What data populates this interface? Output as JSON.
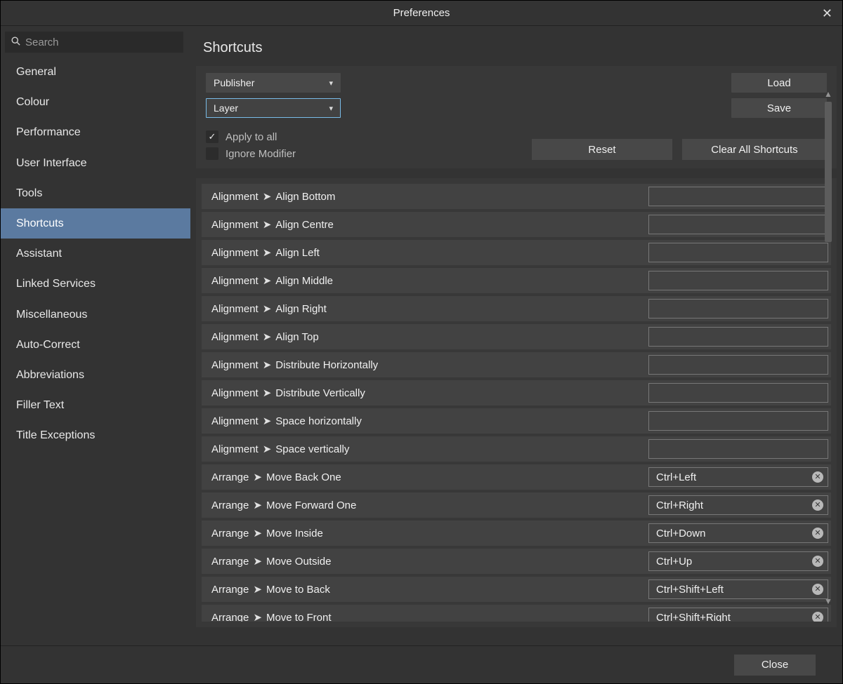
{
  "window": {
    "title": "Preferences"
  },
  "search": {
    "placeholder": "Search"
  },
  "sidebar": {
    "items": [
      {
        "label": "General",
        "selected": false
      },
      {
        "label": "Colour",
        "selected": false
      },
      {
        "label": "Performance",
        "selected": false
      },
      {
        "label": "User Interface",
        "selected": false
      },
      {
        "label": "Tools",
        "selected": false
      },
      {
        "label": "Shortcuts",
        "selected": true
      },
      {
        "label": "Assistant",
        "selected": false
      },
      {
        "label": "Linked Services",
        "selected": false
      },
      {
        "label": "Miscellaneous",
        "selected": false
      },
      {
        "label": "Auto-Correct",
        "selected": false
      },
      {
        "label": "Abbreviations",
        "selected": false
      },
      {
        "label": "Filler Text",
        "selected": false
      },
      {
        "label": "Title Exceptions",
        "selected": false
      }
    ]
  },
  "main": {
    "heading": "Shortcuts",
    "profile_select": "Publisher",
    "category_select": "Layer",
    "load_label": "Load",
    "save_label": "Save",
    "apply_all": {
      "label": "Apply to all",
      "checked": true
    },
    "ignore_modifier": {
      "label": "Ignore Modifier",
      "checked": false
    },
    "reset_label": "Reset",
    "clear_all_label": "Clear All Shortcuts"
  },
  "shortcuts": [
    {
      "group": "Alignment",
      "action": "Align Bottom",
      "key": ""
    },
    {
      "group": "Alignment",
      "action": "Align Centre",
      "key": ""
    },
    {
      "group": "Alignment",
      "action": "Align Left",
      "key": ""
    },
    {
      "group": "Alignment",
      "action": "Align Middle",
      "key": ""
    },
    {
      "group": "Alignment",
      "action": "Align Right",
      "key": ""
    },
    {
      "group": "Alignment",
      "action": "Align Top",
      "key": ""
    },
    {
      "group": "Alignment",
      "action": "Distribute Horizontally",
      "key": ""
    },
    {
      "group": "Alignment",
      "action": "Distribute Vertically",
      "key": ""
    },
    {
      "group": "Alignment",
      "action": "Space horizontally",
      "key": ""
    },
    {
      "group": "Alignment",
      "action": "Space vertically",
      "key": ""
    },
    {
      "group": "Arrange",
      "action": "Move Back One",
      "key": "Ctrl+Left"
    },
    {
      "group": "Arrange",
      "action": "Move Forward One",
      "key": "Ctrl+Right"
    },
    {
      "group": "Arrange",
      "action": "Move Inside",
      "key": "Ctrl+Down"
    },
    {
      "group": "Arrange",
      "action": "Move Outside",
      "key": "Ctrl+Up"
    },
    {
      "group": "Arrange",
      "action": "Move to Back",
      "key": "Ctrl+Shift+Left"
    },
    {
      "group": "Arrange",
      "action": "Move to Front",
      "key": "Ctrl+Shift+Right"
    }
  ],
  "footer": {
    "close_label": "Close"
  }
}
